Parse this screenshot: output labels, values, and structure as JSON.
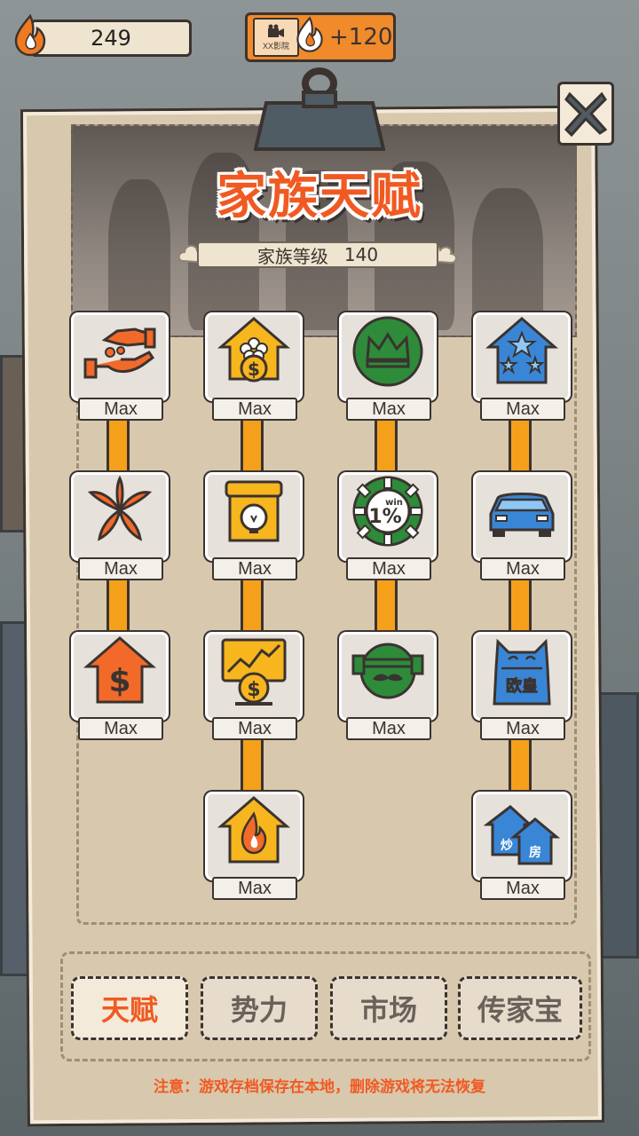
{
  "resources": {
    "flame_count": "249",
    "ticket_label": "XX影院",
    "ticket_bonus": "+120"
  },
  "panel": {
    "title": "家族天赋",
    "level_label": "家族等级",
    "level_value": "140",
    "close_icon": "close-x-icon"
  },
  "tree": {
    "columns": [
      {
        "nodes": [
          {
            "icon": "hand-coins-icon",
            "status": "Max"
          },
          {
            "icon": "lily-flower-icon",
            "status": "Max"
          },
          {
            "icon": "dollar-house-icon",
            "status": "Max"
          }
        ]
      },
      {
        "nodes": [
          {
            "icon": "coin-house-icon",
            "status": "Max"
          },
          {
            "icon": "shop-bulb-icon",
            "status": "Max"
          },
          {
            "icon": "stock-monitor-icon",
            "status": "Max"
          },
          {
            "icon": "flame-house-icon",
            "status": "Max"
          }
        ]
      },
      {
        "nodes": [
          {
            "icon": "crown-icon",
            "status": "Max"
          },
          {
            "icon": "casino-chip-icon",
            "status": "Max",
            "chip_text": "1%",
            "chip_sub": "win"
          },
          {
            "icon": "mustache-face-icon",
            "status": "Max"
          }
        ]
      },
      {
        "nodes": [
          {
            "icon": "star-house-icon",
            "status": "Max"
          },
          {
            "icon": "car-icon",
            "status": "Max"
          },
          {
            "icon": "lucky-cat-icon",
            "status": "Max",
            "cat_text": "欧皇"
          },
          {
            "icon": "houses-icon",
            "status": "Max",
            "houses_text_1": "炒",
            "houses_text_2": "房"
          }
        ]
      }
    ]
  },
  "tabs": [
    {
      "label": "天赋",
      "active": true
    },
    {
      "label": "势力",
      "active": false
    },
    {
      "label": "市场",
      "active": false
    },
    {
      "label": "传家宝",
      "active": false
    }
  ],
  "notice": "注意：游戏存档保存在本地，删除游戏将无法恢复",
  "colors": {
    "accent": "#f05a22",
    "connector": "#f5a01a",
    "outline": "#3b3330",
    "panel": "#d8c8ad"
  }
}
